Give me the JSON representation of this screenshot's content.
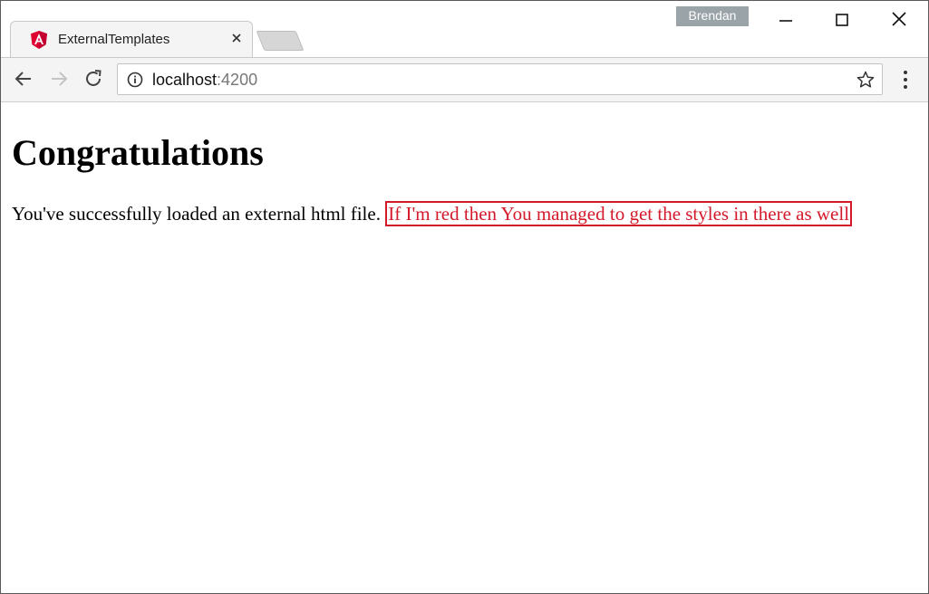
{
  "browser": {
    "tab": {
      "title": "ExternalTemplates",
      "favicon": "angular-logo-icon"
    },
    "profile_name": "Brendan",
    "address_bar": {
      "host": "localhost",
      "port": ":4200"
    },
    "window_controls": [
      "minimize-icon",
      "maximize-icon",
      "close-icon"
    ],
    "toolbar_icons": [
      "back-arrow-icon",
      "forward-arrow-icon",
      "reload-icon",
      "info-icon",
      "star-icon",
      "menu-icon"
    ]
  },
  "page": {
    "heading": "Congratulations",
    "message": "You've successfully loaded an external html file.",
    "styled_message": "If I'm red then You managed to get the styles in there as well"
  },
  "colors": {
    "accent_red": "#d41a2a",
    "angular_red": "#dd0031",
    "profile_badge": "#9aa3a8"
  }
}
